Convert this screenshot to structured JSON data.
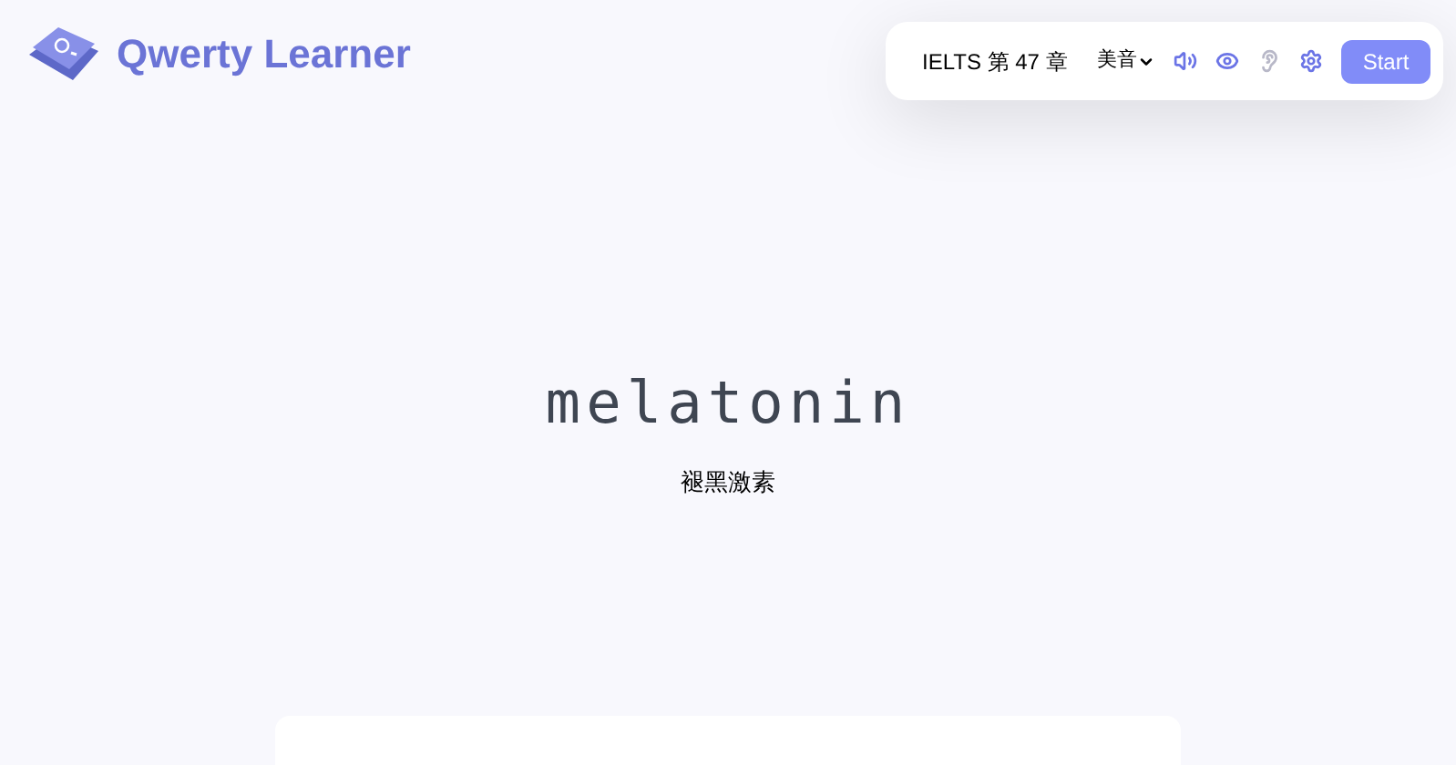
{
  "brand": {
    "name": "Qwerty Learner"
  },
  "toolbar": {
    "chapter": "IELTS 第 47 章",
    "accent": "美音",
    "toggles": [
      {
        "kind": "sound",
        "on": true
      },
      {
        "kind": "eye",
        "on": true
      },
      {
        "kind": "ear",
        "on": false
      },
      {
        "kind": "settings",
        "on": true
      }
    ],
    "start": "Start"
  },
  "word": {
    "text": "melatonin",
    "translation": "褪黑激素"
  }
}
